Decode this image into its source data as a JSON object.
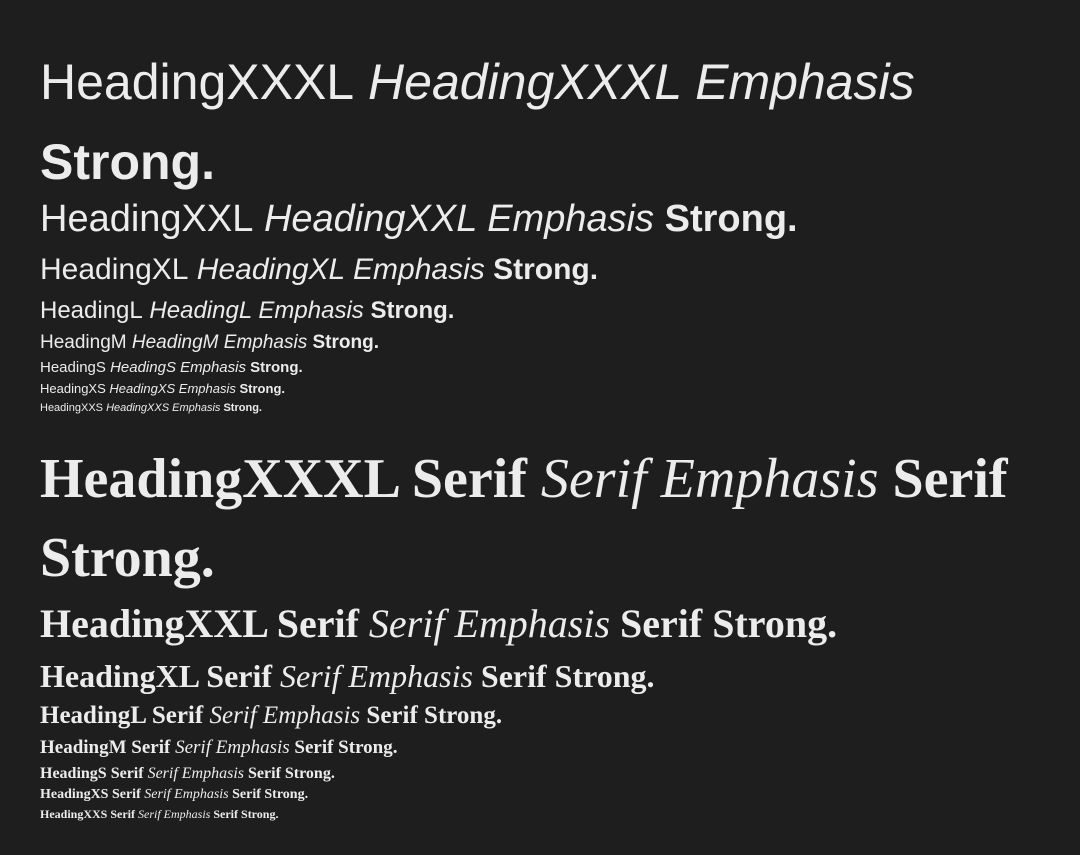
{
  "background_color": "#1e1e1e",
  "text_color": "#ececec",
  "sans_rows": [
    {
      "base": "HeadingXXXL",
      "emphasis": "HeadingXXXL Emphasis",
      "strong": "Strong",
      "end": "."
    },
    {
      "base": "HeadingXXL",
      "emphasis": "HeadingXXL Emphasis",
      "strong": "Strong",
      "end": "."
    },
    {
      "base": "HeadingXL",
      "emphasis": "HeadingXL Emphasis",
      "strong": "Strong",
      "end": "."
    },
    {
      "base": "HeadingL",
      "emphasis": "HeadingL Emphasis",
      "strong": "Strong",
      "end": "."
    },
    {
      "base": "HeadingM",
      "emphasis": "HeadingM Emphasis",
      "strong": "Strong",
      "end": "."
    },
    {
      "base": "HeadingS",
      "emphasis": "HeadingS Emphasis",
      "strong": "Strong",
      "end": "."
    },
    {
      "base": "HeadingXS",
      "emphasis": "HeadingXS Emphasis",
      "strong": "Strong",
      "end": "."
    },
    {
      "base": "HeadingXXS",
      "emphasis": "HeadingXXS Emphasis",
      "strong": "Strong",
      "end": "."
    }
  ],
  "serif_rows": [
    {
      "base": "HeadingXXXL Serif",
      "emphasis": "Serif Emphasis",
      "strong": "Serif Strong",
      "end": "."
    },
    {
      "base": "HeadingXXL Serif",
      "emphasis": "Serif Emphasis",
      "strong": "Serif Strong",
      "end": "."
    },
    {
      "base": "HeadingXL Serif",
      "emphasis": "Serif Emphasis",
      "strong": "Serif Strong",
      "end": "."
    },
    {
      "base": "HeadingL Serif",
      "emphasis": "Serif Emphasis",
      "strong": "Serif Strong",
      "end": "."
    },
    {
      "base": "HeadingM Serif",
      "emphasis": "Serif Emphasis",
      "strong": "Serif Strong",
      "end": "."
    },
    {
      "base": "HeadingS Serif",
      "emphasis": "Serif Emphasis",
      "strong": "Serif Strong",
      "end": "."
    },
    {
      "base": "HeadingXS Serif",
      "emphasis": "Serif Emphasis",
      "strong": "Serif Strong",
      "end": "."
    },
    {
      "base": "HeadingXXS Serif",
      "emphasis": "Serif Emphasis",
      "strong": "Serif Strong",
      "end": "."
    }
  ]
}
